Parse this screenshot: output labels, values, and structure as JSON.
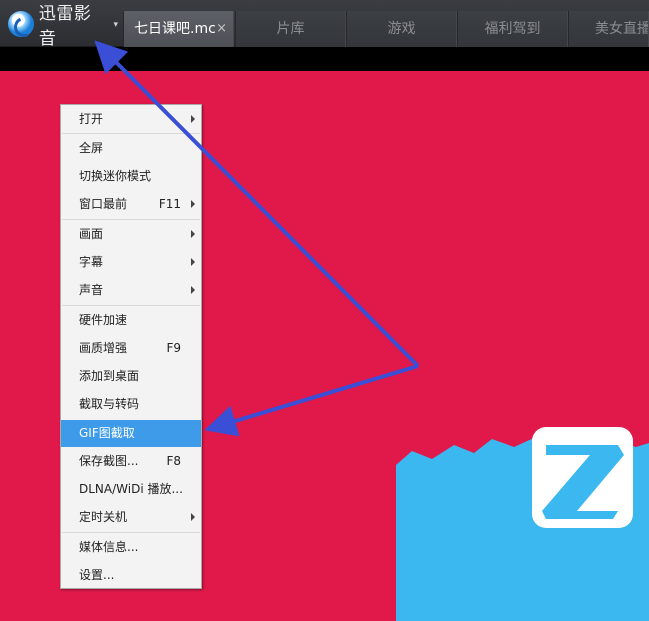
{
  "app": {
    "name": "迅雷影音",
    "menu_caret": "▾",
    "logo_icon": "xunlei-logo-icon"
  },
  "tabs": [
    {
      "label": "七日课吧.mc",
      "close": "×",
      "active": true
    },
    {
      "label": "片库",
      "active": false
    },
    {
      "label": "游戏",
      "active": false
    },
    {
      "label": "福利驾到",
      "active": false
    },
    {
      "label": "美女直播",
      "active": false
    }
  ],
  "menu": {
    "items": [
      {
        "label": "打开",
        "submenu": true
      },
      {
        "label": "全屏"
      },
      {
        "label": "切换迷你模式"
      },
      {
        "label": "窗口最前",
        "shortcut": "F11",
        "submenu": true
      },
      {
        "label": "画面",
        "submenu": true
      },
      {
        "label": "字幕",
        "submenu": true
      },
      {
        "label": "声音",
        "submenu": true
      },
      {
        "label": "硬件加速"
      },
      {
        "label": "画质增强",
        "shortcut": "F9"
      },
      {
        "label": "添加到桌面"
      },
      {
        "label": "截取与转码"
      },
      {
        "label": "GIF图截取",
        "highlighted": true
      },
      {
        "label": "保存截图...",
        "shortcut": "F8"
      },
      {
        "label": "DLNA/WiDi 播放..."
      },
      {
        "label": "定时关机",
        "submenu": true
      },
      {
        "label": "媒体信息..."
      },
      {
        "label": "设置..."
      }
    ]
  },
  "colors": {
    "video_background": "#e0194a",
    "logo_blue": "#3bb8f0",
    "menu_highlight": "#3d9be9",
    "annotation_arrow": "#3a4fd6"
  }
}
